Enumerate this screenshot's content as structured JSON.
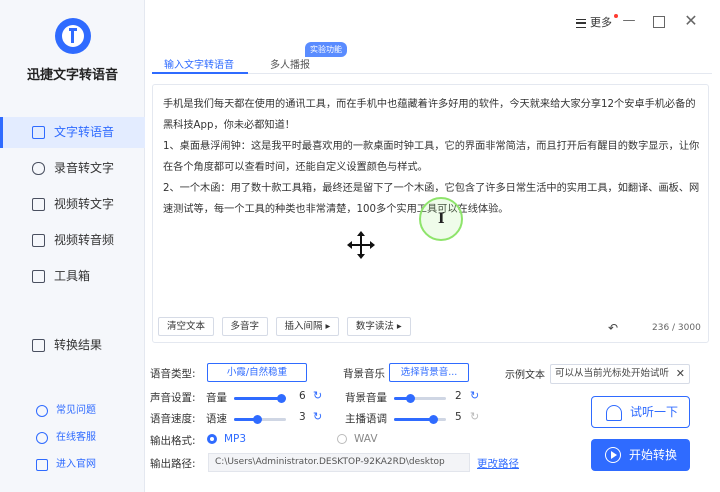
{
  "app": {
    "name": "迅捷文字转语音"
  },
  "sidebar": {
    "items": [
      {
        "label": "文字转语音",
        "active": true
      },
      {
        "label": "录音转文字"
      },
      {
        "label": "视频转文字"
      },
      {
        "label": "视频转音频"
      },
      {
        "label": "工具箱"
      }
    ],
    "result_label": "转换结果",
    "footer": [
      "常见问题",
      "在线客服",
      "进入官网"
    ]
  },
  "titlebar": {
    "menu_label": "更多"
  },
  "tabs": {
    "items": [
      "输入文字转语音",
      "多人播报"
    ],
    "badge": "实验功能"
  },
  "editor": {
    "paragraphs": [
      "手机是我们每天都在使用的通讯工具，而在手机中也蕴藏着许多好用的软件，今天就来给大家分享12个安卓手机必备的黑科技App，你未必都知道！",
      "1、桌面悬浮闹钟：这是我平时最喜欢用的一款桌面时钟工具，它的界面非常简洁，而且打开后有醒目的数字显示，让你在各个角度都可以查看时间，还能自定义设置颜色与样式。",
      "2、一个木函：用了数十款工具箱，最终还是留下了一个木函，它包含了许多日常生活中的实用工具，如翻译、画板、网速测试等，每一个工具的种类也非常清楚，100多个实用工具可以在线体验。"
    ],
    "tools": [
      "清空文本",
      "多音字",
      "插入间隔 ▸",
      "数字读法 ▸"
    ],
    "counter": "236 / 3000",
    "undo_icon": "undo-icon"
  },
  "settings": {
    "voice_type_label": "语音类型:",
    "voice_type_value": "小霞/自然稳重",
    "bgm_label": "背景音乐",
    "bgm_value": "选择背景音...",
    "sample_label": "示例文本",
    "sample_value": "可以从当前光标处开始试听",
    "sound_label": "声音设置:",
    "volume_label": "音量",
    "volume_value": "6",
    "bg_volume_label": "背景音量",
    "bg_volume_value": "2",
    "speed_label": "语音速度:",
    "speed_sub_label": "语速",
    "speed_value": "3",
    "pitch_label": "主播语调",
    "pitch_value": "5",
    "format_label": "输出格式:",
    "format_mp3": "MP3",
    "format_wav": "WAV",
    "path_label": "输出路径:",
    "path_value": "C:\\Users\\Administrator.DESKTOP-92KA2RD\\desktop",
    "change_path": "更改路径"
  },
  "levels": {
    "volume": 0.6,
    "bg_volume": 0.2,
    "speed": 0.3,
    "pitch": 0.5
  },
  "actions": {
    "listen": "试听一下",
    "start": "开始转换"
  },
  "colors": {
    "accent": "#2f6bff",
    "cursor_ring": "#8ee46b"
  }
}
